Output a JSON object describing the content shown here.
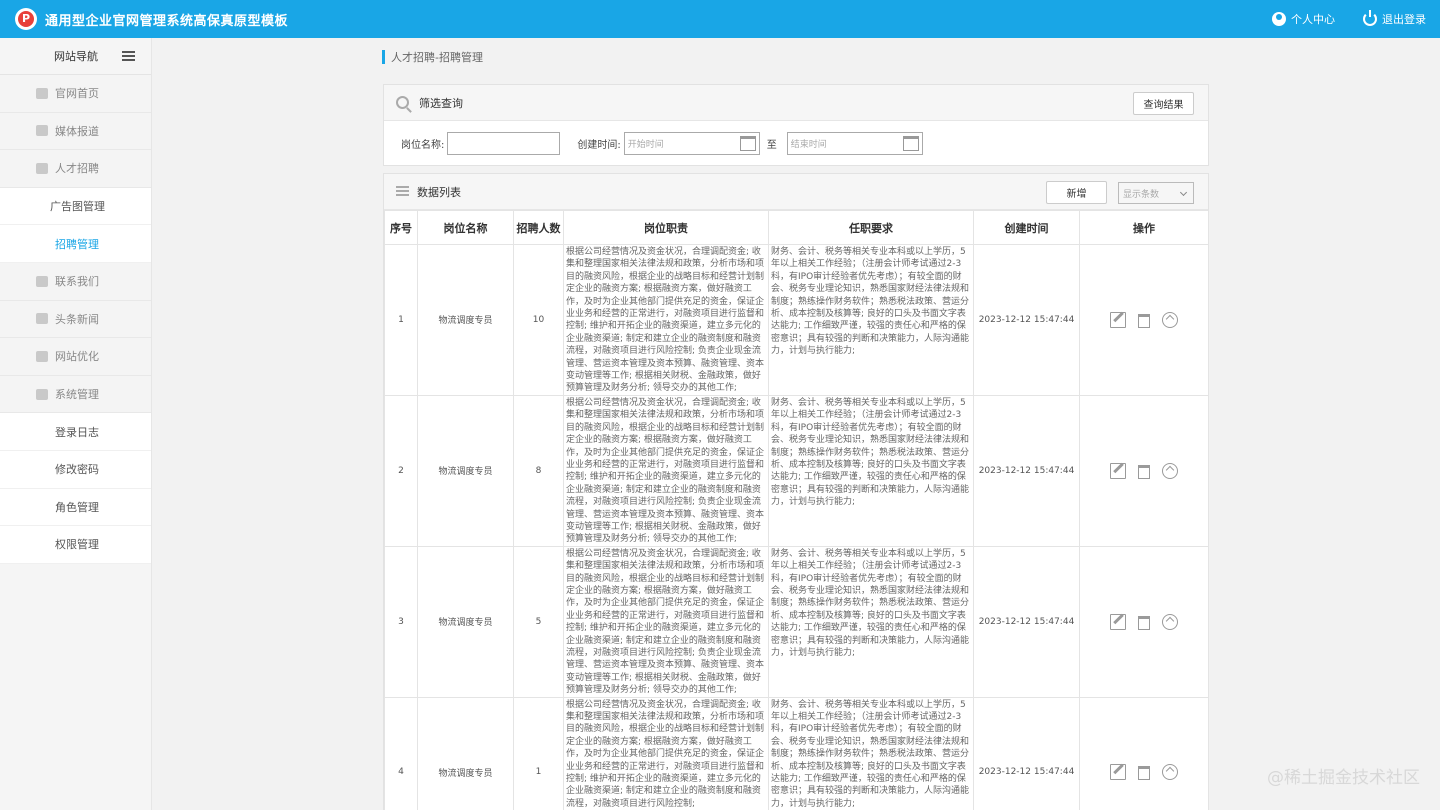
{
  "app": {
    "title": "通用型企业官网管理系统高保真原型模板",
    "profile": "个人中心",
    "logout": "退出登录"
  },
  "sidebar": {
    "header": "网站导航",
    "items": [
      {
        "label": "官网首页"
      },
      {
        "label": "媒体报道"
      },
      {
        "label": "人才招聘"
      },
      {
        "label": "广告图管理"
      },
      {
        "label": "招聘管理"
      },
      {
        "label": "联系我们"
      },
      {
        "label": "头条新闻"
      },
      {
        "label": "网站优化"
      },
      {
        "label": "系统管理"
      },
      {
        "label": "登录日志"
      },
      {
        "label": "修改密码"
      },
      {
        "label": "角色管理"
      },
      {
        "label": "权限管理"
      }
    ]
  },
  "breadcrumb": "人才招聘-招聘管理",
  "filter": {
    "title": "筛选查询",
    "query_button": "查询结果",
    "job_label": "岗位名称:",
    "job_value": "",
    "time_label": "创建时间:",
    "start_placeholder": "开始时间",
    "to": "至",
    "end_placeholder": "结束时间"
  },
  "list": {
    "title": "数据列表",
    "add_button": "新增",
    "page_size_placeholder": "显示条数",
    "columns": [
      "序号",
      "岗位名称",
      "招聘人数",
      "岗位职责",
      "任职要求",
      "创建时间",
      "操作"
    ],
    "rows": [
      {
        "no": "1",
        "name": "物流调度专员",
        "count": "10",
        "duty": "根据公司经营情况及资金状况，合理调配资金; 收集和整理国家相关法律法规和政策，分析市场和项目的融资风险，根据企业的战略目标和经营计划制定企业的融资方案; 根据融资方案，做好融资工作，及时为企业其他部门提供充足的资金，保证企业业务和经营的正常进行，对融资项目进行监督和控制; 维护和开拓企业的融资渠道，建立多元化的企业融资渠道; 制定和建立企业的融资制度和融资流程，对融资项目进行风险控制; 负责企业现金流管理、营运资本管理及资本预算、融资管理、资本变动管理等工作; 根据相关财税、金融政策，做好预算管理及财务分析; 领导交办的其他工作;",
        "req": "财务、会计、税务等相关专业本科或以上学历，5年以上相关工作经验；（注册会计师考试通过2-3科，有IPO审计经验者优先考虑）；有较全面的财会、税务专业理论知识，熟悉国家财经法律法规和制度；熟练操作财务软件；熟悉税法政策、营运分析、成本控制及核算等; 良好的口头及书面文字表达能力; 工作细致严谨，较强的责任心和严格的保密意识；具有较强的判断和决策能力，人际沟通能力，计划与执行能力;",
        "time": "2023-12-12 15:47:44"
      },
      {
        "no": "2",
        "name": "物流调度专员",
        "count": "8",
        "duty": "根据公司经营情况及资金状况，合理调配资金; 收集和整理国家相关法律法规和政策，分析市场和项目的融资风险，根据企业的战略目标和经营计划制定企业的融资方案; 根据融资方案，做好融资工作，及时为企业其他部门提供充足的资金，保证企业业务和经营的正常进行，对融资项目进行监督和控制; 维护和开拓企业的融资渠道，建立多元化的企业融资渠道; 制定和建立企业的融资制度和融资流程，对融资项目进行风险控制; 负责企业现金流管理、营运资本管理及资本预算、融资管理、资本变动管理等工作; 根据相关财税、金融政策，做好预算管理及财务分析; 领导交办的其他工作;",
        "req": "财务、会计、税务等相关专业本科或以上学历，5年以上相关工作经验；（注册会计师考试通过2-3科，有IPO审计经验者优先考虑）；有较全面的财会、税务专业理论知识，熟悉国家财经法律法规和制度；熟练操作财务软件；熟悉税法政策、营运分析、成本控制及核算等; 良好的口头及书面文字表达能力; 工作细致严谨，较强的责任心和严格的保密意识；具有较强的判断和决策能力，人际沟通能力，计划与执行能力;",
        "time": "2023-12-12 15:47:44"
      },
      {
        "no": "3",
        "name": "物流调度专员",
        "count": "5",
        "duty": "根据公司经营情况及资金状况，合理调配资金; 收集和整理国家相关法律法规和政策，分析市场和项目的融资风险，根据企业的战略目标和经营计划制定企业的融资方案; 根据融资方案，做好融资工作，及时为企业其他部门提供充足的资金，保证企业业务和经营的正常进行，对融资项目进行监督和控制; 维护和开拓企业的融资渠道，建立多元化的企业融资渠道; 制定和建立企业的融资制度和融资流程，对融资项目进行风险控制; 负责企业现金流管理、营运资本管理及资本预算、融资管理、资本变动管理等工作; 根据相关财税、金融政策，做好预算管理及财务分析; 领导交办的其他工作;",
        "req": "财务、会计、税务等相关专业本科或以上学历，5年以上相关工作经验；（注册会计师考试通过2-3科，有IPO审计经验者优先考虑）；有较全面的财会、税务专业理论知识，熟悉国家财经法律法规和制度；熟练操作财务软件；熟悉税法政策、营运分析、成本控制及核算等; 良好的口头及书面文字表达能力; 工作细致严谨，较强的责任心和严格的保密意识；具有较强的判断和决策能力，人际沟通能力，计划与执行能力;",
        "time": "2023-12-12 15:47:44"
      },
      {
        "no": "4",
        "name": "物流调度专员",
        "count": "1",
        "duty": "根据公司经营情况及资金状况，合理调配资金; 收集和整理国家相关法律法规和政策，分析市场和项目的融资风险，根据企业的战略目标和经营计划制定企业的融资方案; 根据融资方案，做好融资工作，及时为企业其他部门提供充足的资金，保证企业业务和经营的正常进行，对融资项目进行监督和控制; 维护和开拓企业的融资渠道，建立多元化的企业融资渠道; 制定和建立企业的融资制度和融资流程，对融资项目进行风险控制;",
        "req": "财务、会计、税务等相关专业本科或以上学历，5年以上相关工作经验；（注册会计师考试通过2-3科，有IPO审计经验者优先考虑）；有较全面的财会、税务专业理论知识，熟悉国家财经法律法规和制度；熟练操作财务软件；熟悉税法政策、营运分析、成本控制及核算等; 良好的口头及书面文字表达能力; 工作细致严谨，较强的责任心和严格的保密意识；具有较强的判断和决策能力，人际沟通能力，计划与执行能力;",
        "time": "2023-12-12 15:47:44"
      }
    ]
  },
  "watermark": "@稀土掘金技术社区",
  "colors": {
    "accent": "#19a6e6",
    "logo": "#e8403a"
  }
}
